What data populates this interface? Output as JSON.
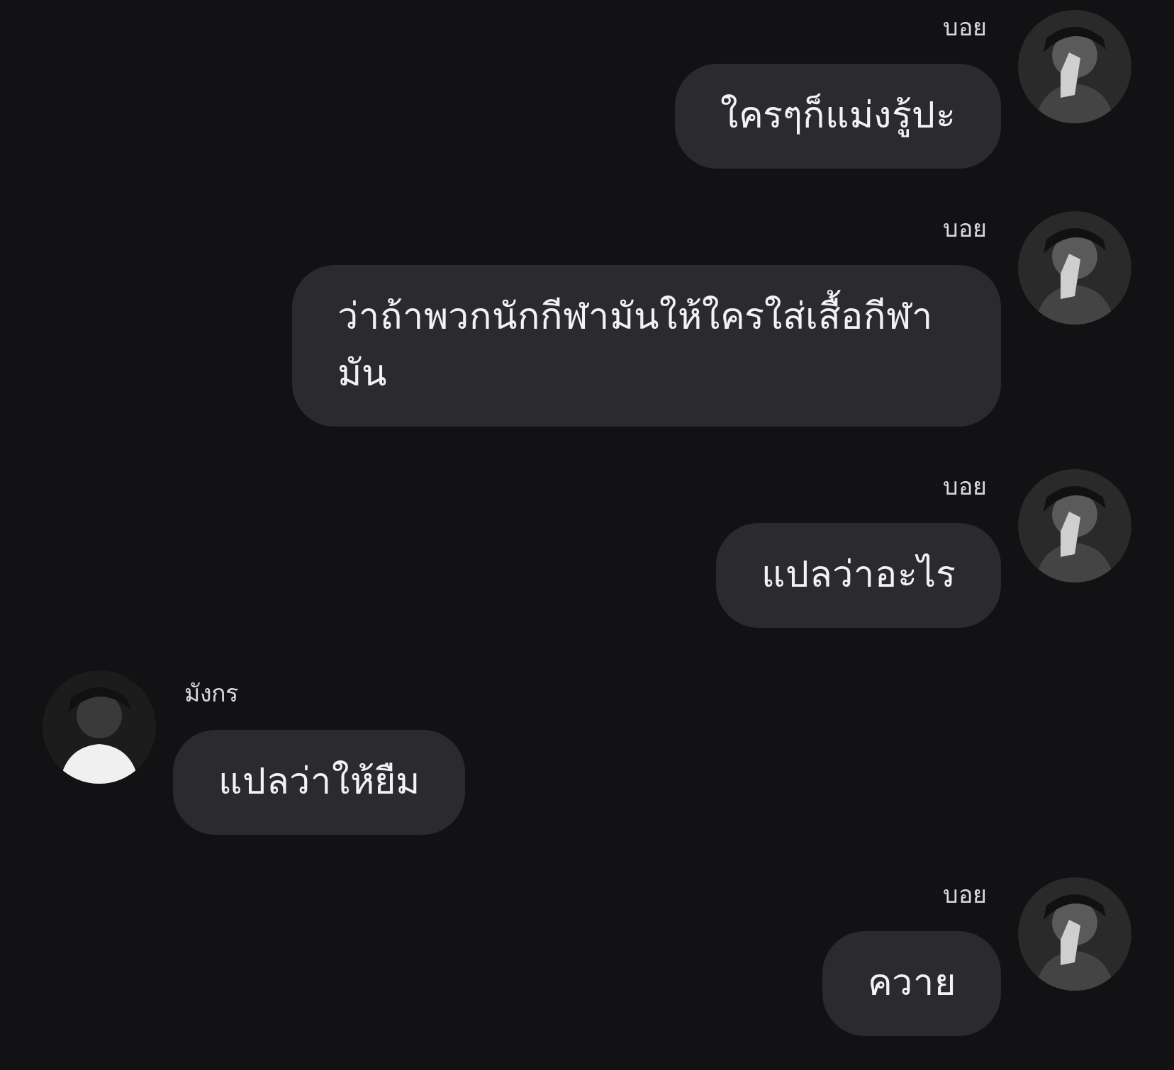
{
  "messages": [
    {
      "kind": "outgoing",
      "sender": "บอย",
      "text": "ใครๆก็แม่งรู้ปะ"
    },
    {
      "kind": "outgoing",
      "sender": "บอย",
      "text": "ว่าถ้าพวกนักกีฬามันให้ใครใส่เสื้อกีฬามัน"
    },
    {
      "kind": "outgoing",
      "sender": "บอย",
      "text": "แปลว่าอะไร"
    },
    {
      "kind": "incoming",
      "sender": "มังกร",
      "text": "แปลว่าให้ยืม"
    },
    {
      "kind": "outgoing",
      "sender": "บอย",
      "text": "ควาย"
    }
  ]
}
